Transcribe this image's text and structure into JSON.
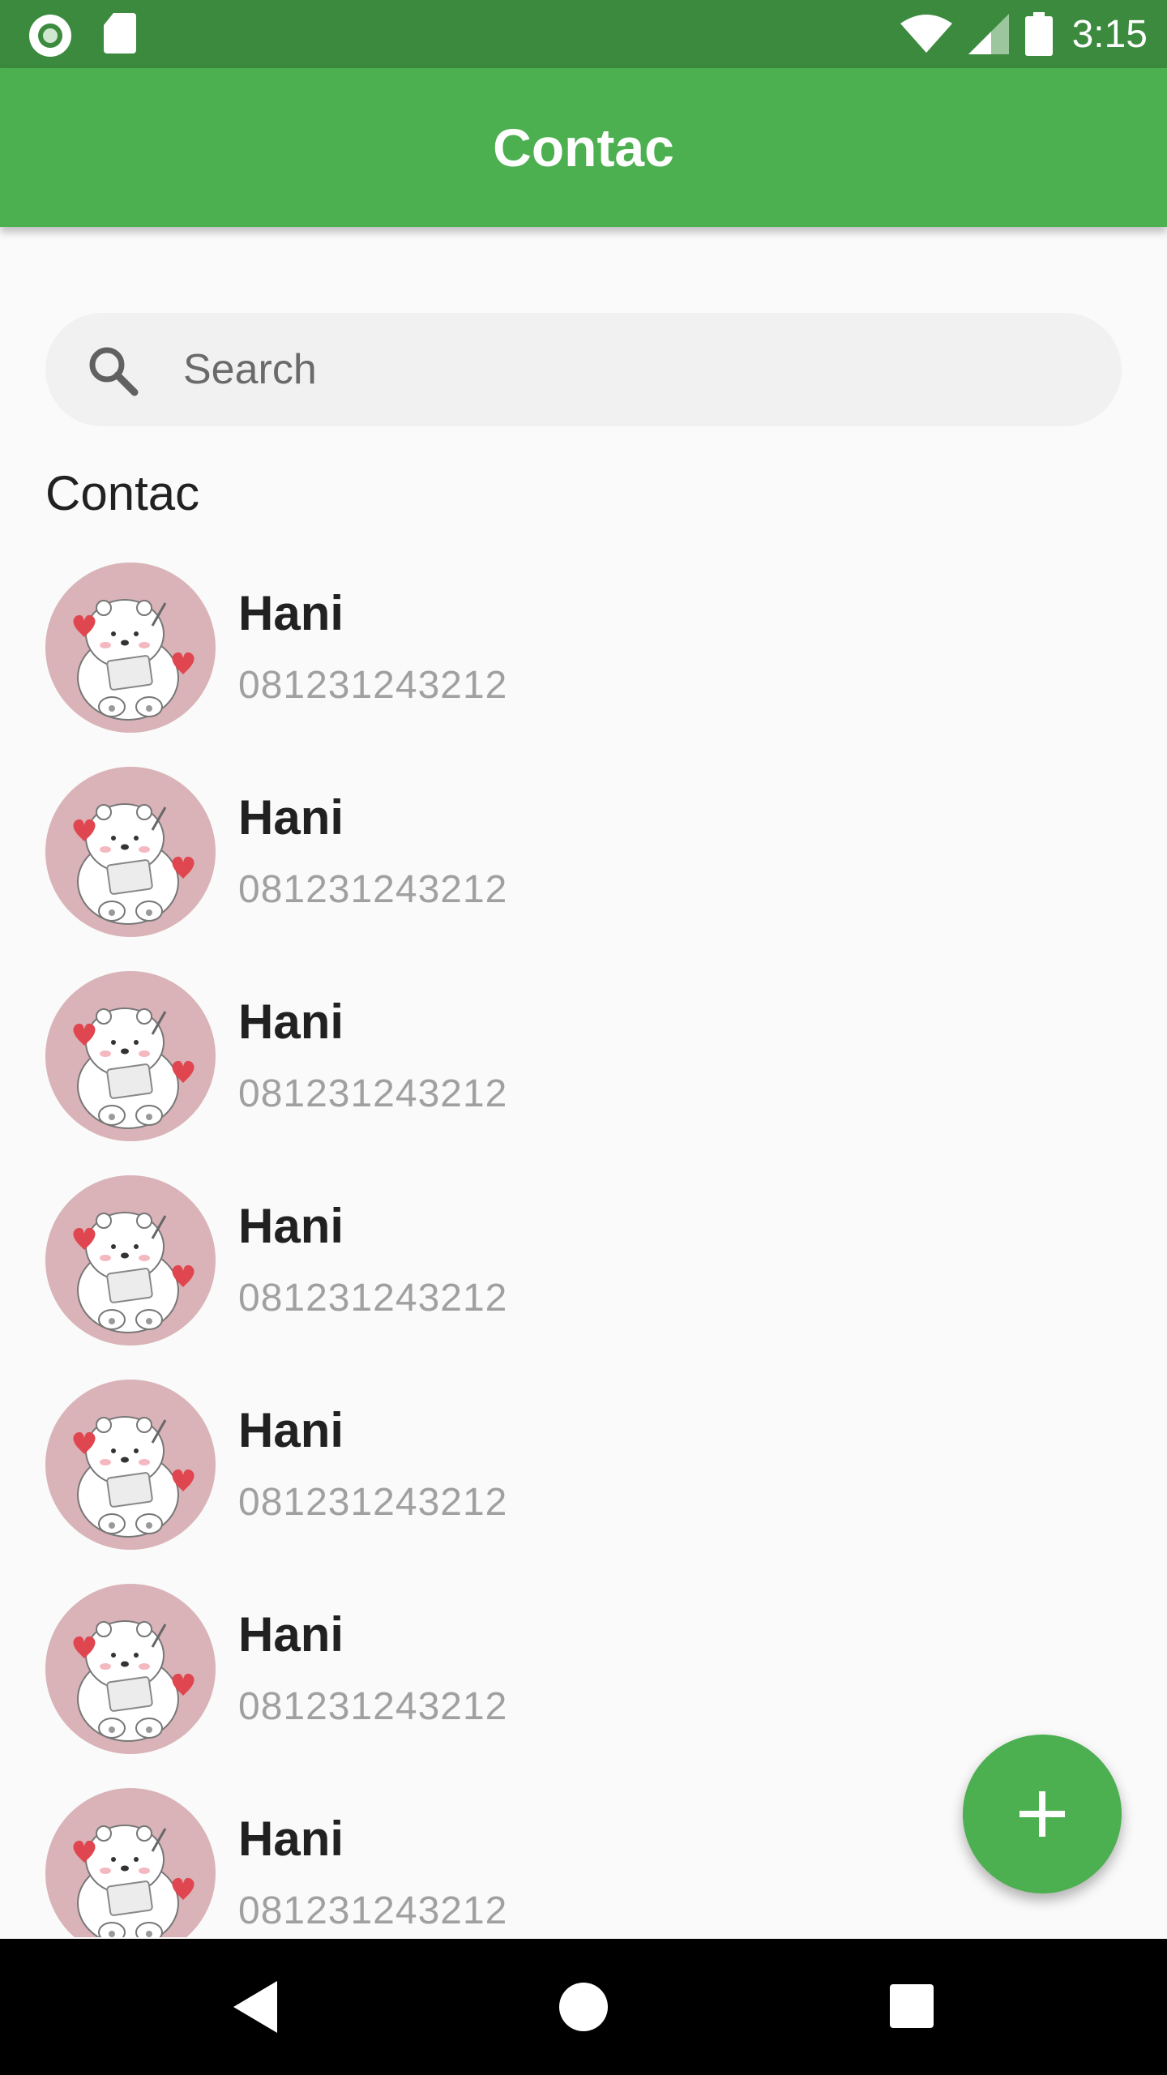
{
  "status_bar": {
    "time": "3:15",
    "icons": [
      "record-icon",
      "sd-card-icon",
      "wifi-icon",
      "signal-icon",
      "battery-icon"
    ]
  },
  "app_bar": {
    "title": "Contac",
    "color": "#4caf50"
  },
  "search": {
    "placeholder": "Search",
    "value": ""
  },
  "section": {
    "title": "Contac"
  },
  "contacts": [
    {
      "name": "Hani",
      "phone": "081231243212"
    },
    {
      "name": "Hani",
      "phone": "081231243212"
    },
    {
      "name": "Hani",
      "phone": "081231243212"
    },
    {
      "name": "Hani",
      "phone": "081231243212"
    },
    {
      "name": "Hani",
      "phone": "081231243212"
    },
    {
      "name": "Hani",
      "phone": "081231243212"
    },
    {
      "name": "Hani",
      "phone": "081231243212"
    }
  ],
  "fab": {
    "icon": "plus-icon"
  },
  "nav_bar": {
    "icons": [
      "back-icon",
      "home-icon",
      "recents-icon"
    ]
  },
  "colors": {
    "status_bar": "#3b8a3e",
    "accent": "#4caf50",
    "avatar_bg": "#d9b3b7"
  }
}
